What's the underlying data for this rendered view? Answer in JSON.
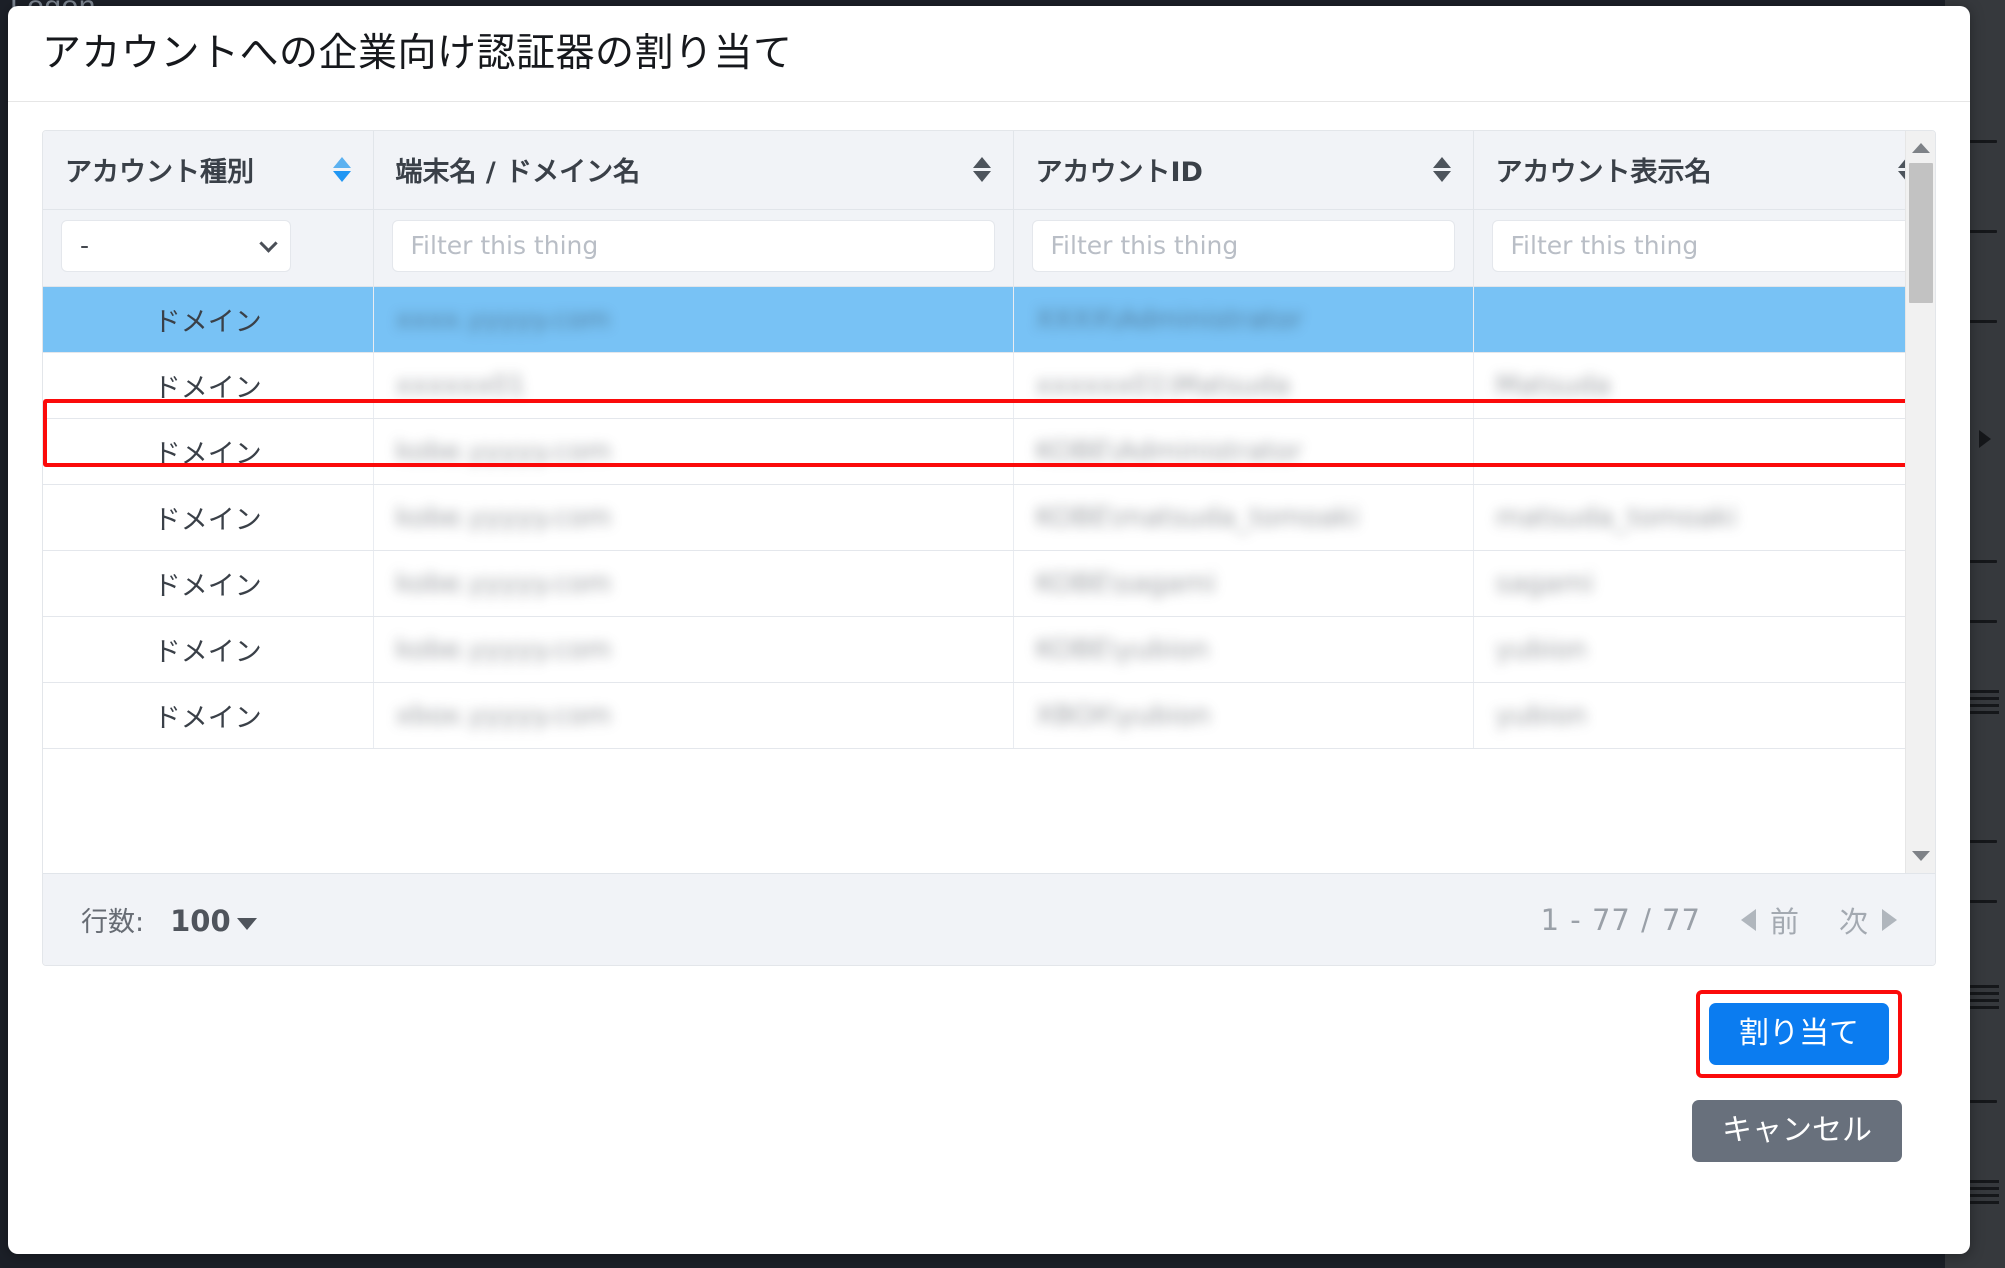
{
  "background": {
    "page_text": "Logon"
  },
  "dialog": {
    "title": "アカウントへの企業向け認証器の割り当て"
  },
  "table": {
    "columns": [
      {
        "label": "アカウント種別",
        "sort": "active",
        "filter_type": "select",
        "filter_value": "-"
      },
      {
        "label": "端末名 / ドメイン名",
        "sort": "inactive",
        "filter_type": "text",
        "filter_placeholder": "Filter this thing"
      },
      {
        "label": "アカウントID",
        "sort": "inactive",
        "filter_type": "text",
        "filter_placeholder": "Filter this thing"
      },
      {
        "label": "アカウント表示名",
        "sort": "inactive",
        "filter_type": "text",
        "filter_placeholder": "Filter this thing"
      }
    ],
    "rows": [
      {
        "type": "ドメイン",
        "host": "xxxx.yyyyy.com",
        "account_id": "XXXX\\Administrator",
        "display_name": "",
        "selected": true
      },
      {
        "type": "ドメイン",
        "host": "xxxxxx01",
        "account_id": "xxxxxx01\\Matsuda",
        "display_name": "Matsuda",
        "selected": false
      },
      {
        "type": "ドメイン",
        "host": "kobe.yyyyy.com",
        "account_id": "KOBE\\Administrator",
        "display_name": "",
        "selected": false
      },
      {
        "type": "ドメイン",
        "host": "kobe.yyyyy.com",
        "account_id": "KOBE\\matsuda_tomoaki",
        "display_name": "matsuda_tomoaki",
        "selected": false
      },
      {
        "type": "ドメイン",
        "host": "kobe.yyyyy.com",
        "account_id": "KOBE\\sagami",
        "display_name": "sagami",
        "selected": false
      },
      {
        "type": "ドメイン",
        "host": "kobe.yyyyy.com",
        "account_id": "KOBE\\yubion",
        "display_name": "yubion",
        "selected": false
      },
      {
        "type": "ドメイン",
        "host": "xbox.yyyyy.com",
        "account_id": "XBOX\\yubion",
        "display_name": "yubion",
        "selected": false
      }
    ]
  },
  "pager": {
    "rows_label": "行数:",
    "rows_value": "100",
    "range": "1 - 77 / 77",
    "prev_label": "前",
    "next_label": "次"
  },
  "actions": {
    "assign_label": "割り当て",
    "cancel_label": "キャンセル"
  },
  "colors": {
    "primary": "#0b7cf0",
    "secondary": "#68707c",
    "selection": "#78c2f5",
    "annotation": "#fb0a0a"
  }
}
